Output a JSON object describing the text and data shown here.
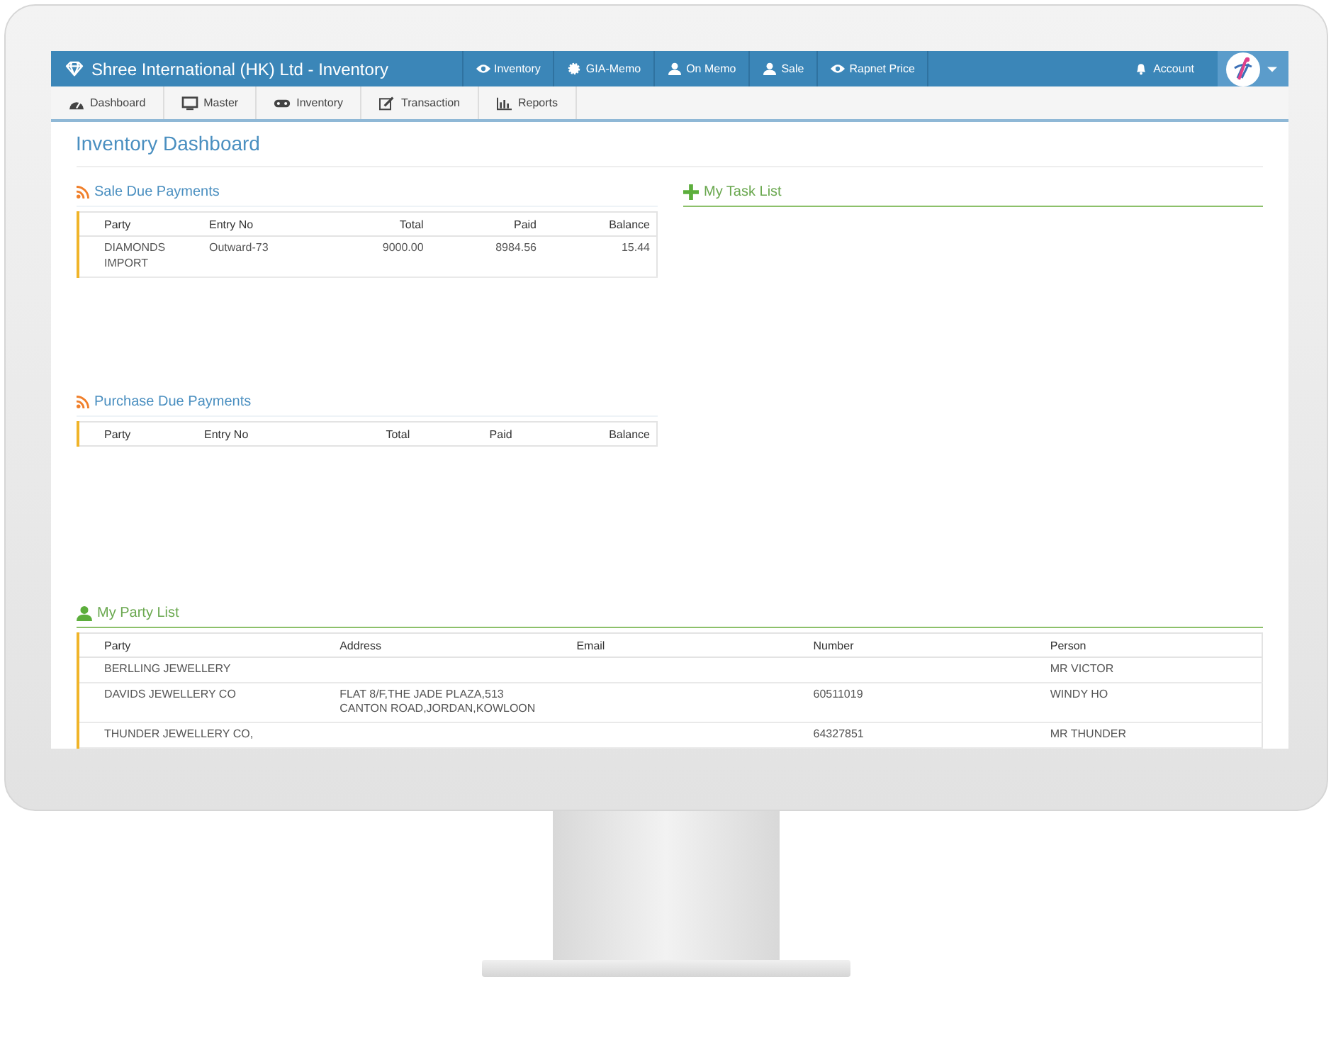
{
  "app": {
    "title": "Shree International (HK) Ltd - Inventory"
  },
  "top_nav": [
    {
      "label": "Inventory",
      "kind": "eye"
    },
    {
      "label": "GIA-Memo",
      "kind": "gear"
    },
    {
      "label": "On Memo",
      "kind": "user"
    },
    {
      "label": "Sale",
      "kind": "user"
    },
    {
      "label": "Rapnet Price",
      "kind": "eye"
    }
  ],
  "account": {
    "label": "Account"
  },
  "sub_nav": [
    {
      "label": "Dashboard",
      "kind": "dashboard"
    },
    {
      "label": "Master",
      "kind": "monitor"
    },
    {
      "label": "Inventory",
      "kind": "gamepad"
    },
    {
      "label": "Transaction",
      "kind": "edit"
    },
    {
      "label": "Reports",
      "kind": "chart"
    }
  ],
  "page": {
    "title": "Inventory Dashboard"
  },
  "sale_due_payments": {
    "title": "Sale Due Payments",
    "columns": [
      "Party",
      "Entry No",
      "Total",
      "Paid",
      "Balance"
    ],
    "rows": [
      [
        "DIAMONDS IMPORT",
        "Outward-73",
        "9000.00",
        "8984.56",
        "15.44"
      ]
    ]
  },
  "purchase_due_payments": {
    "title": "Purchase Due Payments",
    "columns": [
      "Party",
      "Entry No",
      "Total",
      "Paid",
      "Balance"
    ]
  },
  "task_list": {
    "title": "My Task List"
  },
  "party_list": {
    "title": "My Party List",
    "columns": [
      "Party",
      "Address",
      "Email",
      "Number",
      "Person"
    ],
    "rows": [
      [
        "BERLLING JEWELLERY",
        "",
        "",
        "",
        "MR VICTOR"
      ],
      [
        "DAVIDS JEWELLERY CO",
        "FLAT 8/F,THE JADE PLAZA,513 CANTON ROAD,JORDAN,KOWLOON",
        "",
        "60511019",
        "WINDY HO"
      ],
      [
        "THUNDER JEWELLERY CO,",
        "",
        "",
        "64327851",
        "MR THUNDER"
      ]
    ]
  }
}
